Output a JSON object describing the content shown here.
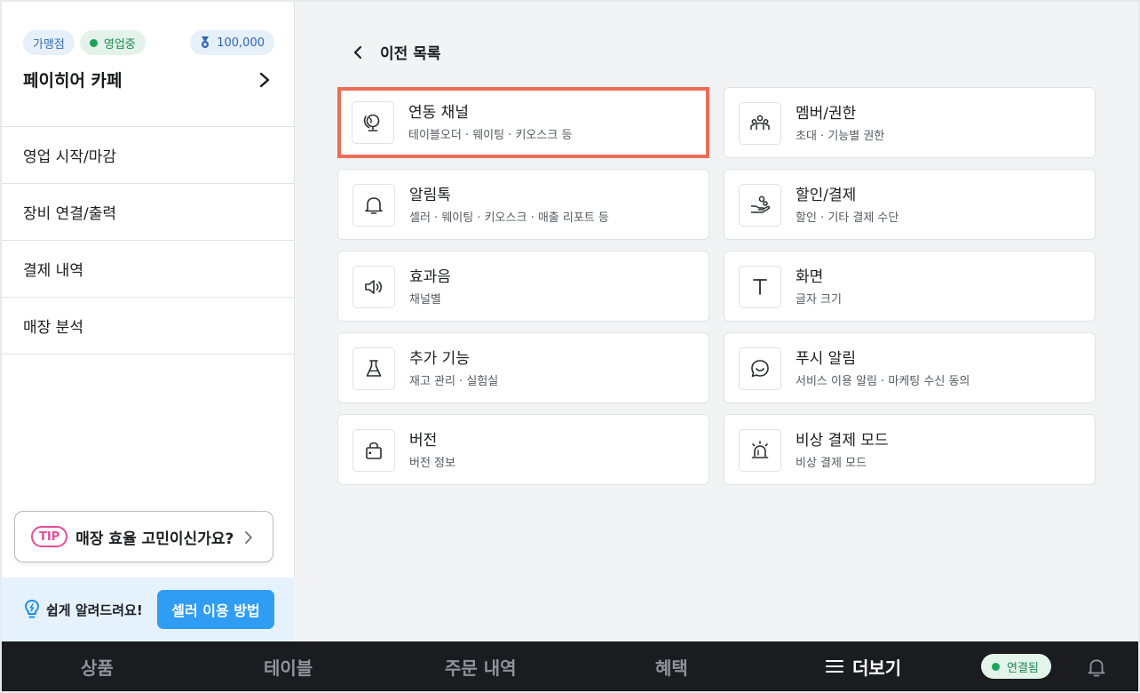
{
  "sidebar": {
    "badges": {
      "franchise": "가맹점",
      "status": "영업중",
      "points": "100,000"
    },
    "store_name": "페이히어 카페",
    "menu": [
      "영업 시작/마감",
      "장비 연결/출력",
      "결제 내역",
      "매장 분석"
    ],
    "tip": {
      "badge": "TIP",
      "text": "매장 효율 고민이신가요?"
    },
    "help": {
      "text": "쉽게 알려드려요!",
      "button": "셀러 이용 방법"
    }
  },
  "main": {
    "back_label": "이전 목록",
    "cards": [
      {
        "title": "연동 채널",
        "sub": "테이블오더 · 웨이팅 · 키오스크 등",
        "icon": "globe-icon"
      },
      {
        "title": "멤버/권한",
        "sub": "초대 · 기능별 권한",
        "icon": "members-icon"
      },
      {
        "title": "알림톡",
        "sub": "셀러 · 웨이팅 · 키오스크 · 매출 리포트 등",
        "icon": "bell-icon"
      },
      {
        "title": "할인/결제",
        "sub": "할인 · 기타 결제 수단",
        "icon": "hand-coin-icon"
      },
      {
        "title": "효과음",
        "sub": "채널별",
        "icon": "speaker-icon"
      },
      {
        "title": "화면",
        "sub": "글자 크기",
        "icon": "text-size-icon"
      },
      {
        "title": "추가 기능",
        "sub": "재고 관리 · 실험실",
        "icon": "flask-icon"
      },
      {
        "title": "푸시 알림",
        "sub": "서비스 이용 알림 · 마케팅 수신 동의",
        "icon": "chat-smile-icon"
      },
      {
        "title": "버전",
        "sub": "버전 정보",
        "icon": "bag-icon"
      },
      {
        "title": "비상 결제 모드",
        "sub": "비상 결제 모드",
        "icon": "siren-icon"
      }
    ]
  },
  "bottom_nav": {
    "tabs": [
      "상품",
      "테이블",
      "주문 내역",
      "혜택",
      "더보기"
    ],
    "connection": "연결됨"
  },
  "colors": {
    "accent_blue": "#2f9df4",
    "highlight_border": "#ee6c58",
    "status_green": "#19a45b",
    "tip_pink": "#ec4a96",
    "nav_bg": "#1a1c20"
  }
}
